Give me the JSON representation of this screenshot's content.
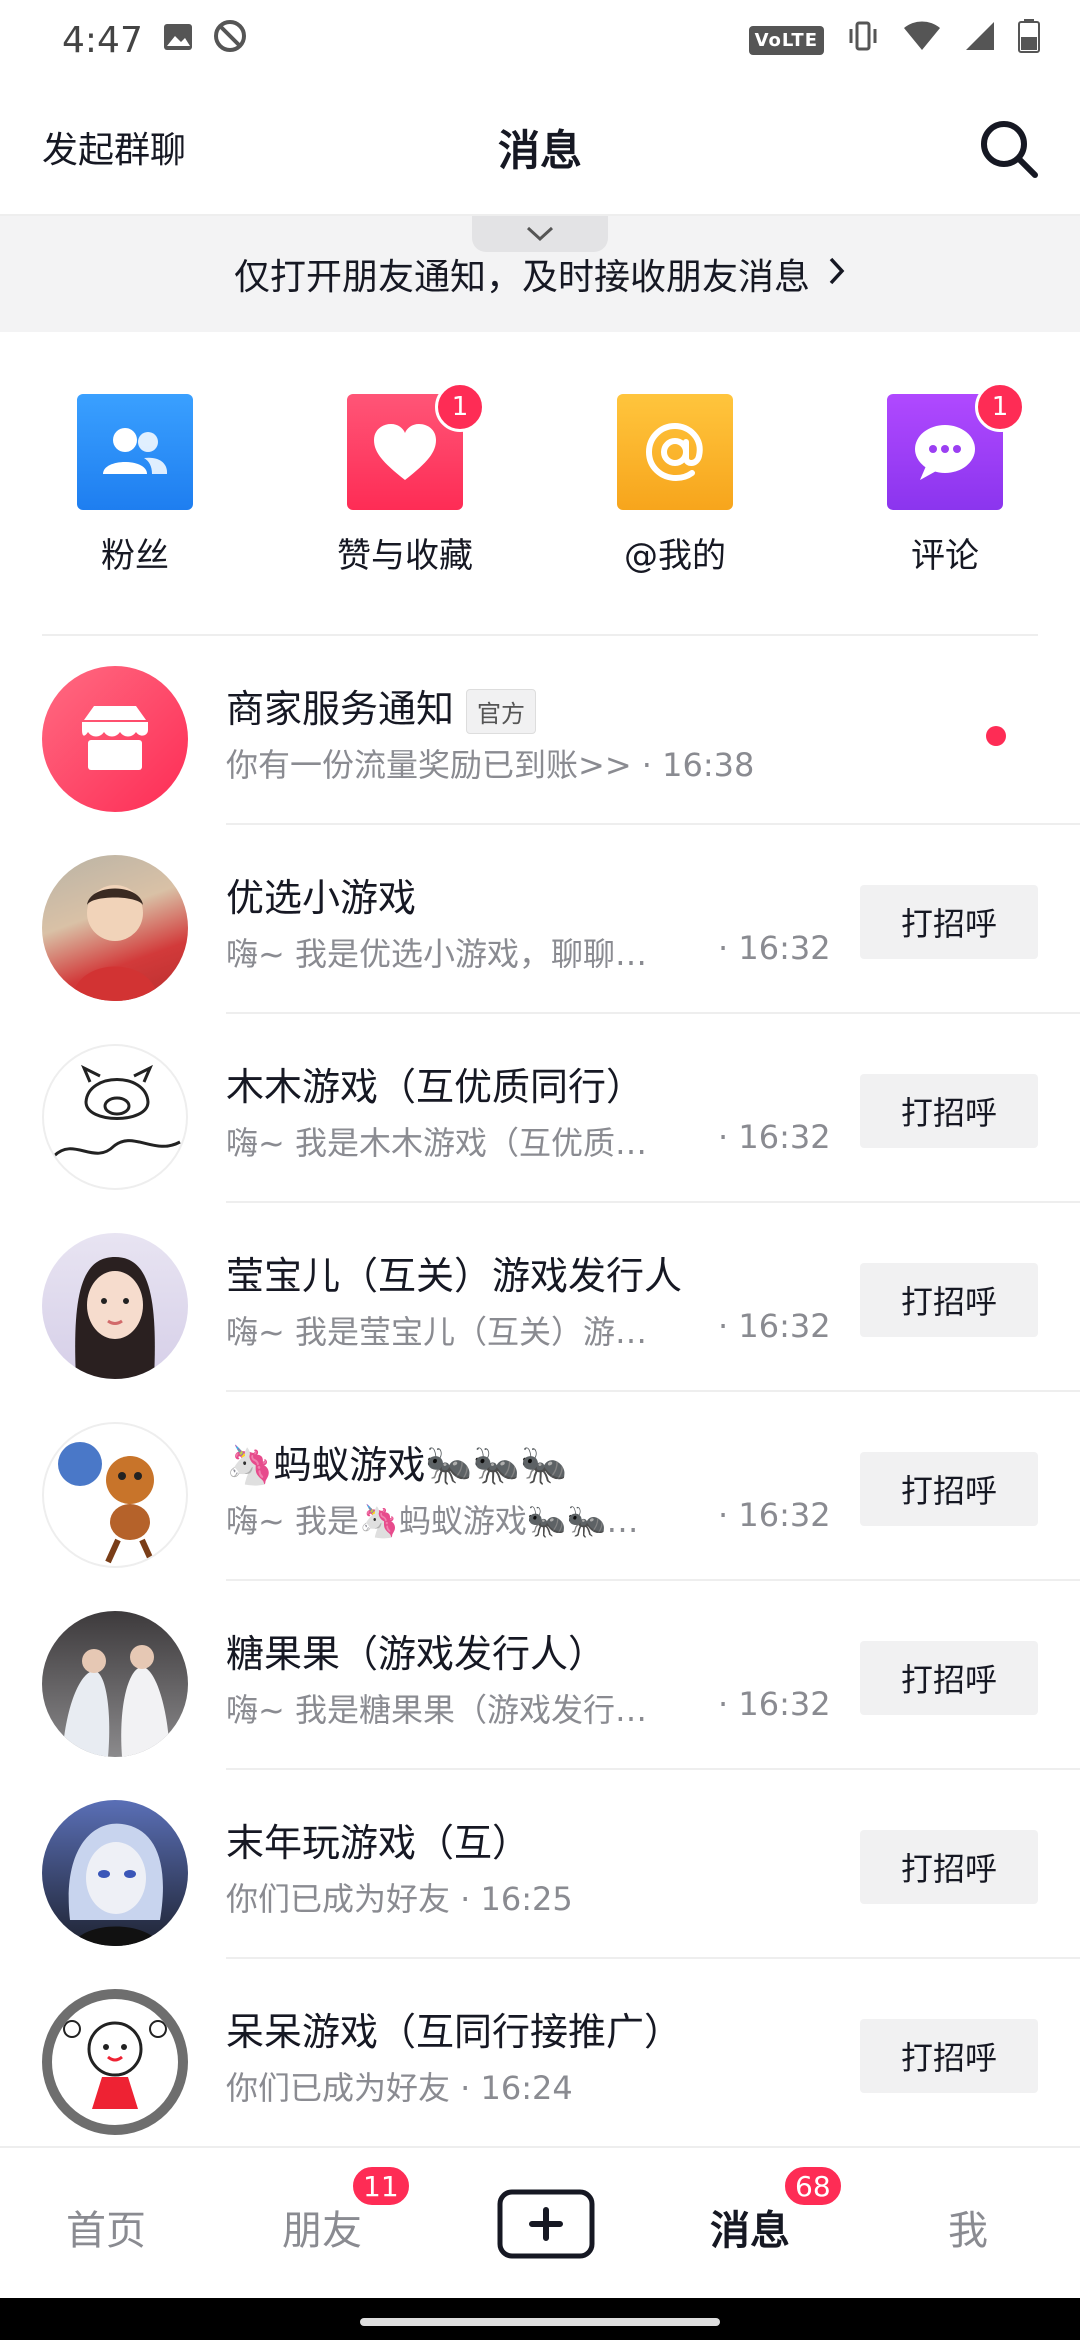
{
  "status": {
    "time": "4:47",
    "volte": "VoLTE"
  },
  "header": {
    "left_action": "发起群聊",
    "title": "消息"
  },
  "banner": {
    "text": "仅打开朋友通知，及时接收朋友消息"
  },
  "quick": [
    {
      "label": "粉丝",
      "color": "#2f8cf0",
      "badge": ""
    },
    {
      "label": "赞与收藏",
      "color": "#fe2c55",
      "badge": "1"
    },
    {
      "label": "@我的",
      "color": "#fcb424",
      "badge": ""
    },
    {
      "label": "评论",
      "color": "#9b3ff2",
      "badge": "1"
    }
  ],
  "official": {
    "name": "商家服务通知",
    "tag": "官方",
    "sub": "你有一份流量奖励已到账>> · 16:38"
  },
  "rows": [
    {
      "name": "优选小游戏",
      "sub": "嗨~ 我是优选小游戏，聊聊…",
      "time": "· 16:32",
      "action": "打招呼"
    },
    {
      "name": "木木游戏（互优质同行）",
      "sub": "嗨~ 我是木木游戏（互优质…",
      "time": "· 16:32",
      "action": "打招呼"
    },
    {
      "name": "莹宝儿（互关）游戏发行人",
      "sub": "嗨~ 我是莹宝儿（互关）游…",
      "time": "· 16:32",
      "action": "打招呼"
    },
    {
      "name": "🦄蚂蚁游戏🐜🐜🐜",
      "sub": "嗨~ 我是🦄蚂蚁游戏🐜🐜…",
      "time": "· 16:32",
      "action": "打招呼"
    },
    {
      "name": "糖果果（游戏发行人）",
      "sub": "嗨~ 我是糖果果（游戏发行…",
      "time": "· 16:32",
      "action": "打招呼"
    },
    {
      "name": "末年玩游戏（互）",
      "sub": "你们已成为好友 · 16:25",
      "time": "",
      "action": "打招呼"
    },
    {
      "name": "呆呆游戏（互同行接推广）",
      "sub": "你们已成为好友 · 16:24",
      "time": "",
      "action": "打招呼"
    }
  ],
  "tabs": {
    "home": "首页",
    "friends": "朋友",
    "friends_badge": "11",
    "messages": "消息",
    "messages_badge": "68",
    "me": "我"
  }
}
